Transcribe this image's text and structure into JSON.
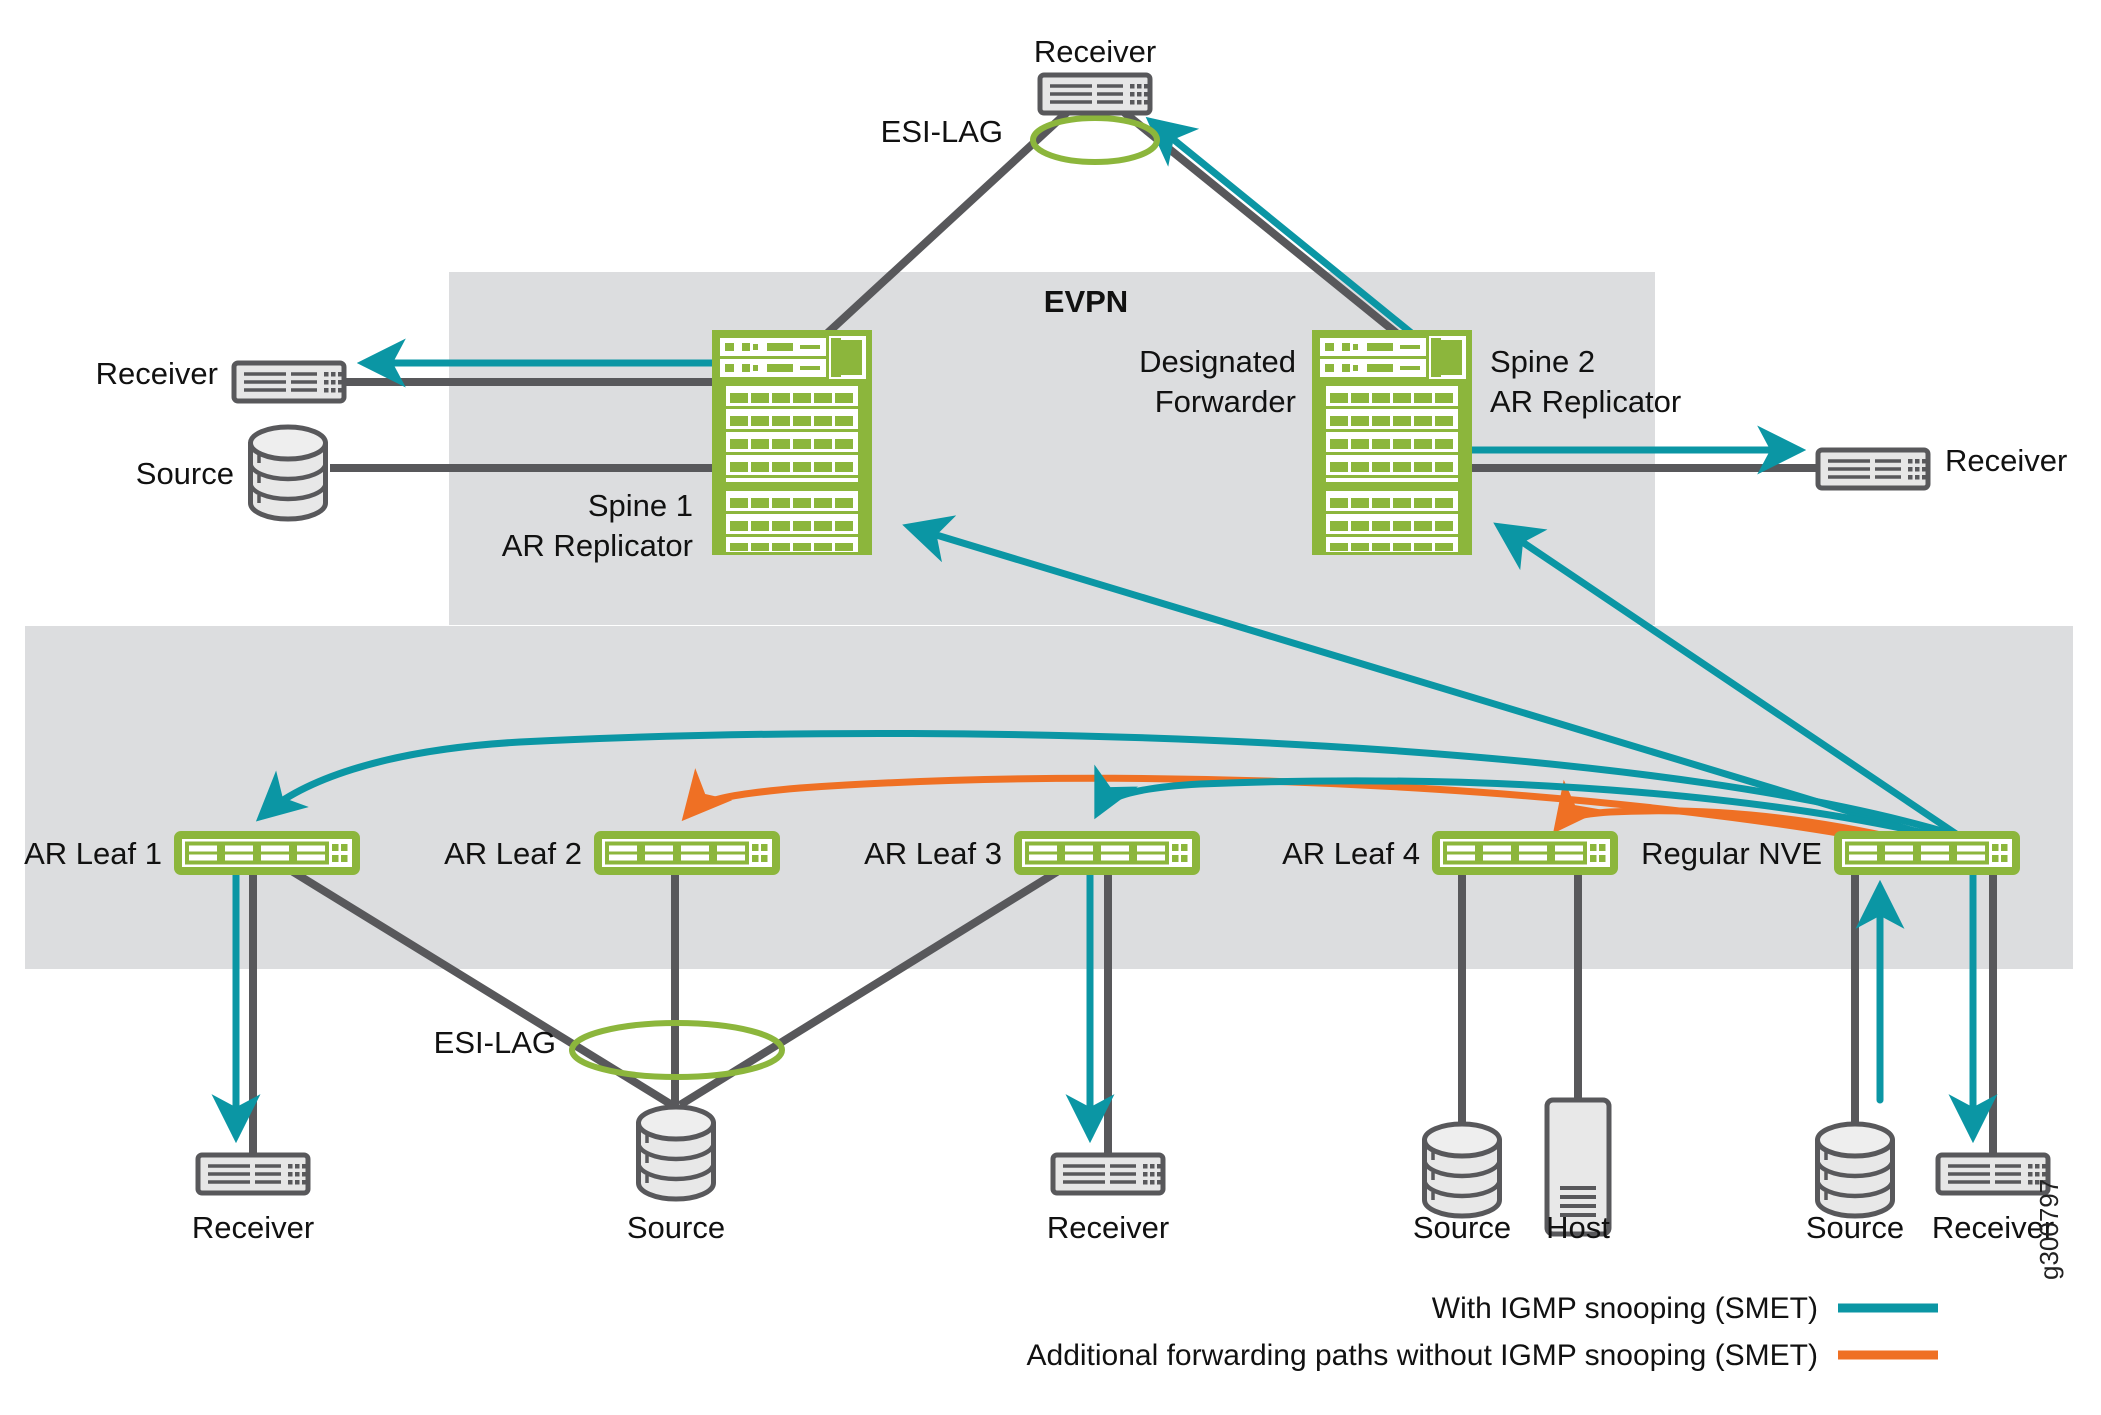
{
  "figure": {
    "id_label": "g300797",
    "zones": [
      {
        "name": "EVPN",
        "label": "EVPN"
      },
      {
        "name": "fabric",
        "label": ""
      }
    ]
  },
  "colors": {
    "teal": "#0b96a4",
    "orange": "#ef7024",
    "green": "#8cb63c",
    "gray_link": "#58585b",
    "zone_bg": "#dcdddf",
    "device_gray_fill": "#e6e6e6",
    "device_gray_stroke": "#58585b",
    "text": "#111111"
  },
  "zone_labels": {
    "evpn": "EVPN"
  },
  "top": {
    "receiver_label": "Receiver",
    "esi_lag_label": "ESI-LAG"
  },
  "spines": [
    {
      "name": "spine-1",
      "label_line1": "Spine 1",
      "label_line2": "AR Replicator",
      "role_label": ""
    },
    {
      "name": "spine-2",
      "label_line1": "Spine 2",
      "label_line2": "AR Replicator",
      "role_label_line1": "Designated",
      "role_label_line2": "Forwarder"
    }
  ],
  "left_side": {
    "receiver_label": "Receiver",
    "source_label": "Source"
  },
  "right_side": {
    "receiver_label": "Receiver"
  },
  "leaves": [
    {
      "name": "ar-leaf-1",
      "label": "AR Leaf 1"
    },
    {
      "name": "ar-leaf-2",
      "label": "AR Leaf 2"
    },
    {
      "name": "ar-leaf-3",
      "label": "AR Leaf 3"
    },
    {
      "name": "ar-leaf-4",
      "label": "AR Leaf 4"
    },
    {
      "name": "regular-nve",
      "label": "Regular NVE"
    }
  ],
  "bottom": {
    "esi_lag_label": "ESI-LAG",
    "endpoints": [
      {
        "name": "receiver-leaf1",
        "label": "Receiver",
        "type": "switch"
      },
      {
        "name": "source-esilag",
        "label": "Source",
        "type": "database"
      },
      {
        "name": "receiver-leaf3",
        "label": "Receiver",
        "type": "switch"
      },
      {
        "name": "source-leaf4",
        "label": "Source",
        "type": "database"
      },
      {
        "name": "host-leaf4",
        "label": "Host",
        "type": "server"
      },
      {
        "name": "source-nve",
        "label": "Source",
        "type": "database"
      },
      {
        "name": "receiver-nve",
        "label": "Receiver",
        "type": "switch"
      }
    ]
  },
  "legend": {
    "items": [
      {
        "name": "legend-with-igmp",
        "label": "With IGMP snooping (SMET)",
        "color": "#0b96a4"
      },
      {
        "name": "legend-without-igmp",
        "label": "Additional forwarding paths without IGMP snooping (SMET)",
        "color": "#ef7024"
      }
    ]
  }
}
